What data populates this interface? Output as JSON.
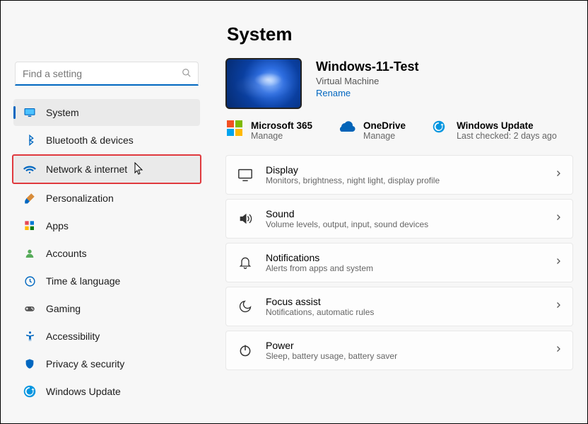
{
  "search": {
    "placeholder": "Find a setting"
  },
  "sidebar": {
    "items": [
      {
        "label": "System",
        "icon": "monitor-icon",
        "state": "selected"
      },
      {
        "label": "Bluetooth & devices",
        "icon": "bluetooth-icon"
      },
      {
        "label": "Network & internet",
        "icon": "wifi-icon",
        "state": "highlight"
      },
      {
        "label": "Personalization",
        "icon": "brush-icon"
      },
      {
        "label": "Apps",
        "icon": "apps-icon"
      },
      {
        "label": "Accounts",
        "icon": "person-icon"
      },
      {
        "label": "Time & language",
        "icon": "globe-clock-icon"
      },
      {
        "label": "Gaming",
        "icon": "gamepad-icon"
      },
      {
        "label": "Accessibility",
        "icon": "accessibility-icon"
      },
      {
        "label": "Privacy & security",
        "icon": "shield-icon"
      },
      {
        "label": "Windows Update",
        "icon": "update-icon"
      }
    ]
  },
  "main": {
    "title": "System",
    "pc": {
      "name": "Windows-11-Test",
      "type": "Virtual Machine",
      "rename": "Rename"
    },
    "services": [
      {
        "title": "Microsoft 365",
        "sub": "Manage",
        "icon": "ms365-icon"
      },
      {
        "title": "OneDrive",
        "sub": "Manage",
        "icon": "onedrive-icon"
      },
      {
        "title": "Windows Update",
        "sub": "Last checked: 2 days ago",
        "icon": "update-icon"
      }
    ],
    "cards": [
      {
        "title": "Display",
        "sub": "Monitors, brightness, night light, display profile",
        "icon": "display-icon"
      },
      {
        "title": "Sound",
        "sub": "Volume levels, output, input, sound devices",
        "icon": "sound-icon"
      },
      {
        "title": "Notifications",
        "sub": "Alerts from apps and system",
        "icon": "bell-icon"
      },
      {
        "title": "Focus assist",
        "sub": "Notifications, automatic rules",
        "icon": "moon-icon"
      },
      {
        "title": "Power",
        "sub": "Sleep, battery usage, battery saver",
        "icon": "power-icon"
      }
    ]
  }
}
